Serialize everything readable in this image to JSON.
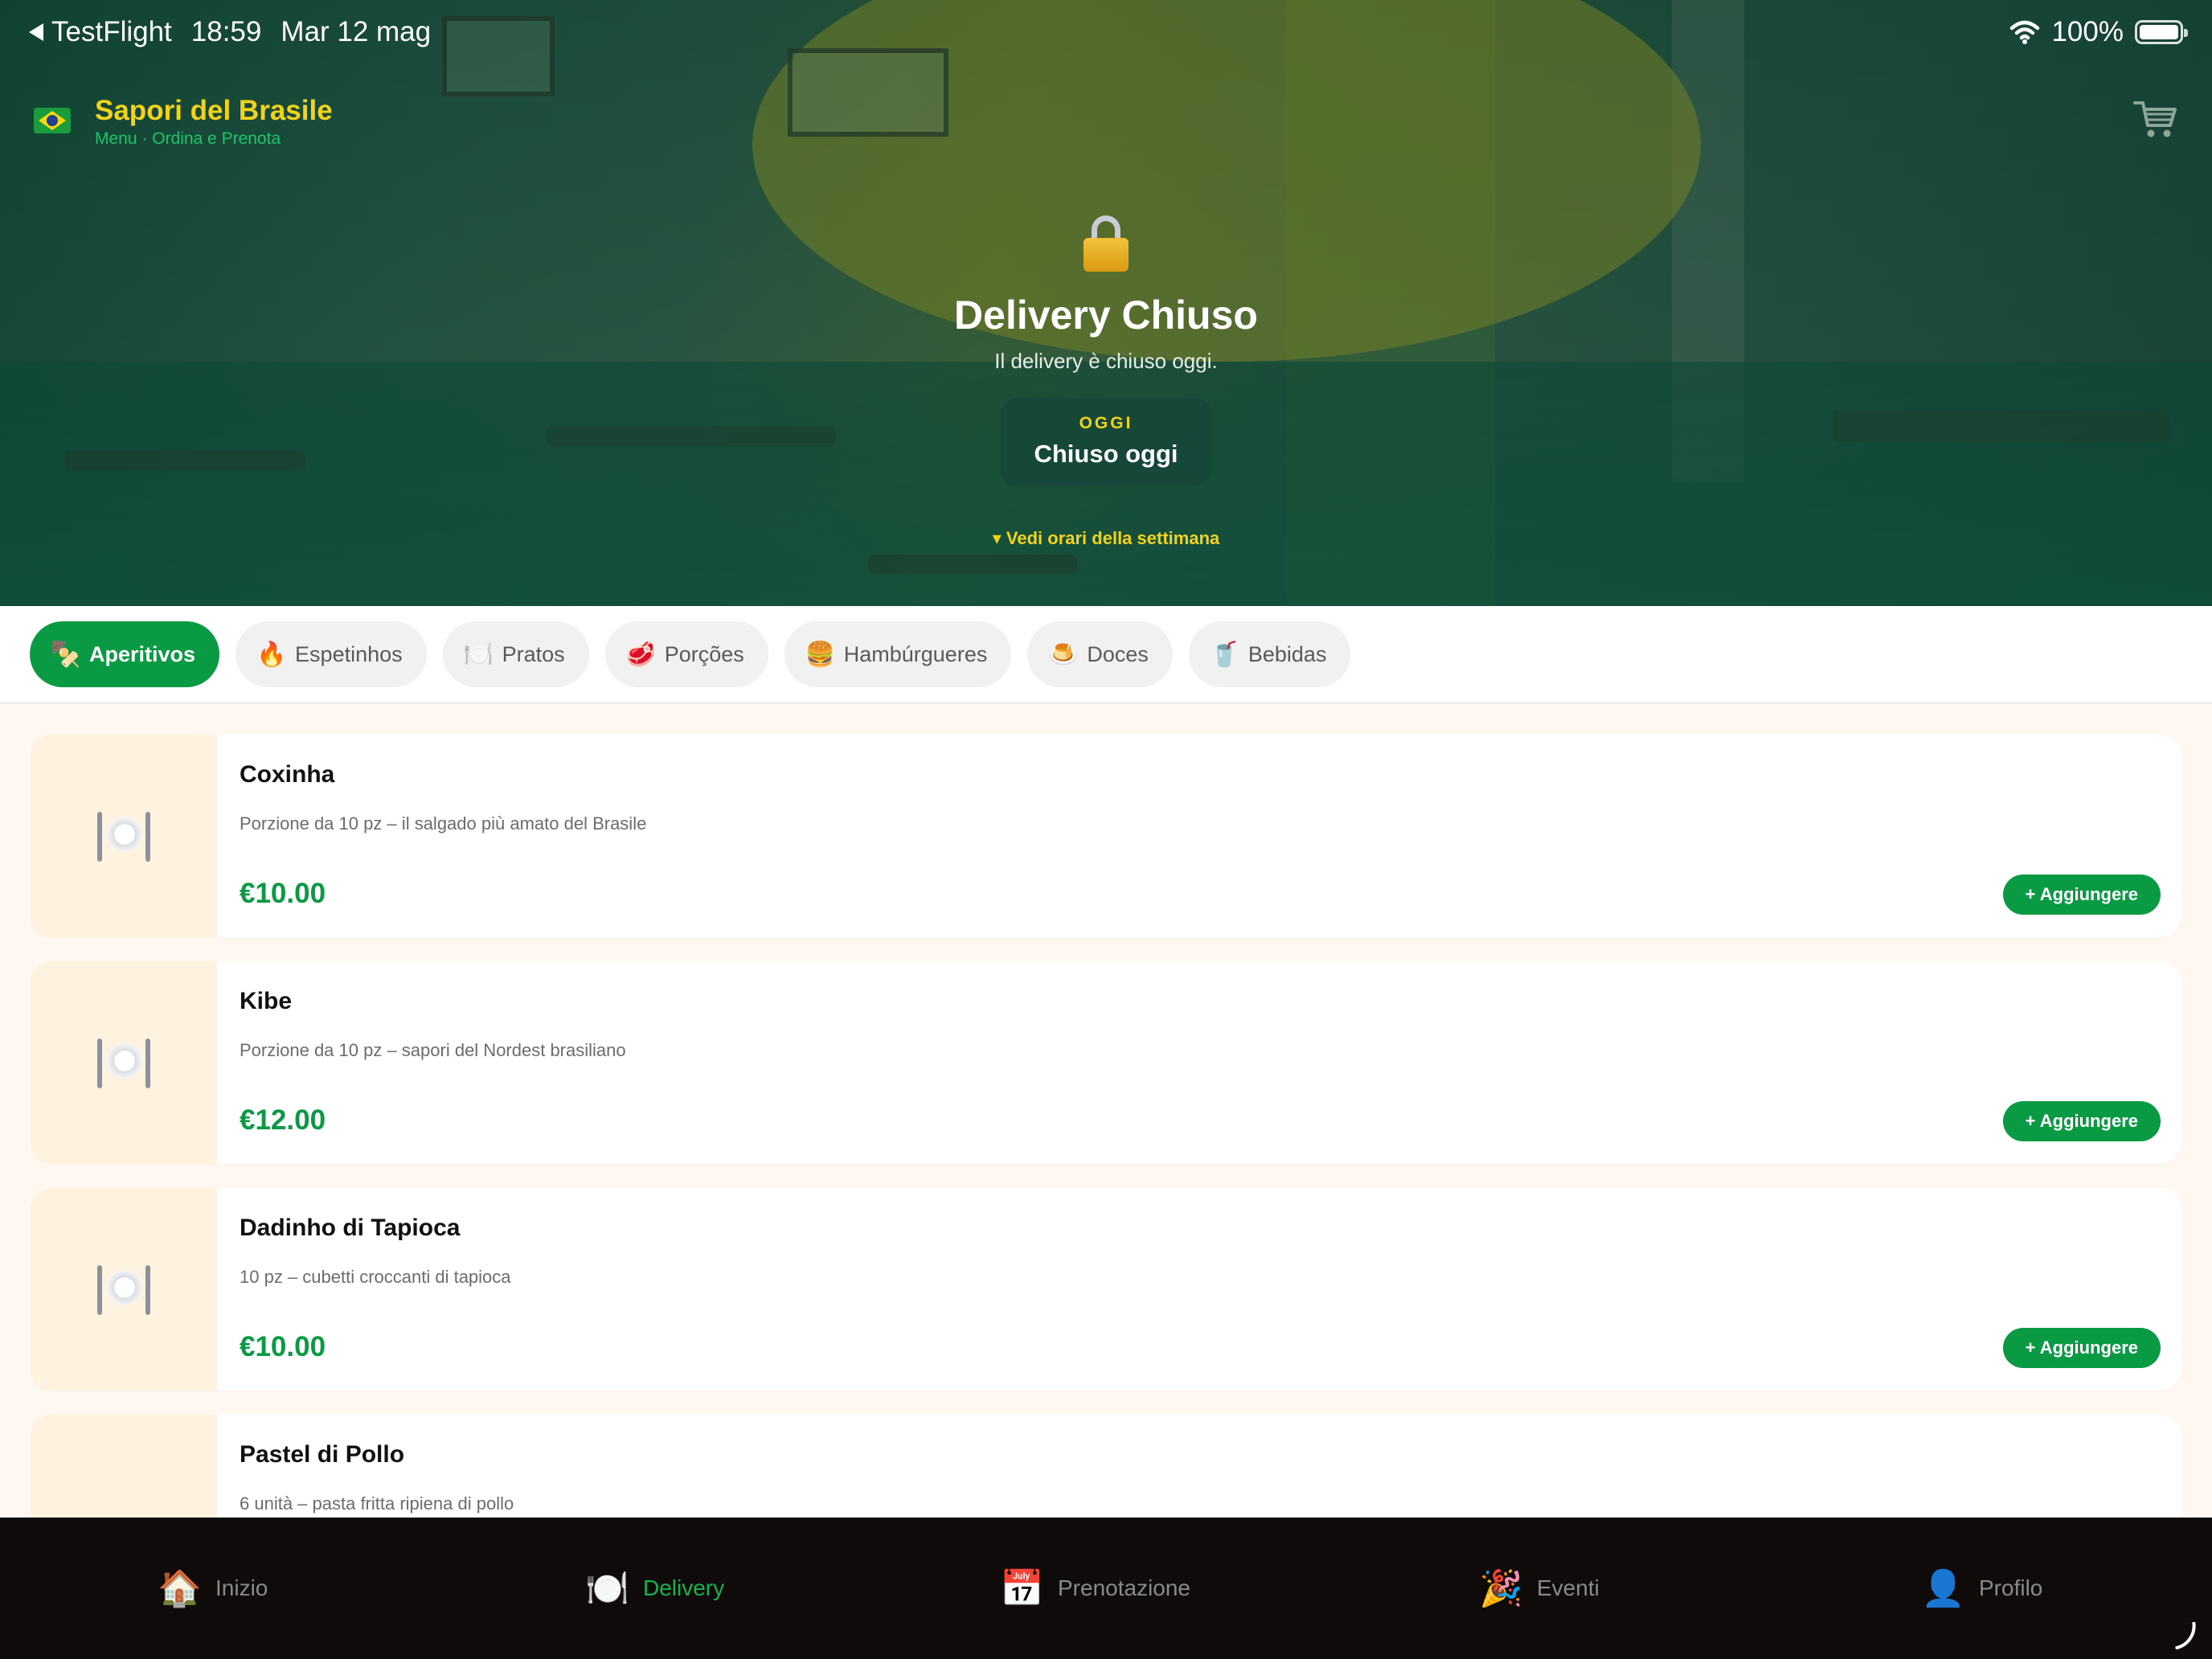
{
  "status_bar": {
    "back_app": "TestFlight",
    "time": "18:59",
    "date": "Mar 12 mag",
    "battery": "100%"
  },
  "brand": {
    "title": "Sapori del Brasile",
    "subtitle": "Menu · Ordina e Prenota"
  },
  "delivery": {
    "title": "Delivery Chiuso",
    "message": "Il delivery è chiuso oggi.",
    "today_label": "OGGI",
    "today_status": "Chiuso oggi",
    "week_link": "▾ Vedi orari della settimana"
  },
  "categories": [
    {
      "label": "Aperitivos",
      "icon": "🍢",
      "active": true
    },
    {
      "label": "Espetinhos",
      "icon": "🔥",
      "active": false
    },
    {
      "label": "Pratos",
      "icon": "🍽️",
      "active": false
    },
    {
      "label": "Porções",
      "icon": "🥩",
      "active": false
    },
    {
      "label": "Hambúrgueres",
      "icon": "🍔",
      "active": false
    },
    {
      "label": "Doces",
      "icon": "🍮",
      "active": false
    },
    {
      "label": "Bebidas",
      "icon": "🥤",
      "active": false
    }
  ],
  "items": [
    {
      "name": "Coxinha",
      "description": "Porzione da 10 pz – il salgado più amato del Brasile",
      "price": "€10.00",
      "add_label": "+ Aggiungere"
    },
    {
      "name": "Kibe",
      "description": "Porzione da 10 pz – sapori del Nordest brasiliano",
      "price": "€12.00",
      "add_label": "+ Aggiungere"
    },
    {
      "name": "Dadinho di Tapioca",
      "description": "10 pz – cubetti croccanti di tapioca",
      "price": "€10.00",
      "add_label": "+ Aggiungere"
    },
    {
      "name": "Pastel di Pollo",
      "description": "6 unità – pasta fritta ripiena di pollo",
      "price": "",
      "add_label": ""
    }
  ],
  "tabs": [
    {
      "label": "Inizio",
      "icon": "🏠",
      "active": false
    },
    {
      "label": "Delivery",
      "icon": "🍽️",
      "active": true
    },
    {
      "label": "Prenotazione",
      "icon": "📅",
      "active": false
    },
    {
      "label": "Eventi",
      "icon": "🎉",
      "active": false
    },
    {
      "label": "Profilo",
      "icon": "👤",
      "active": false
    }
  ],
  "colors": {
    "accent_green": "#0b9a44",
    "brand_yellow": "#f3d21a",
    "tabbar_bg": "#0e0b0a"
  }
}
